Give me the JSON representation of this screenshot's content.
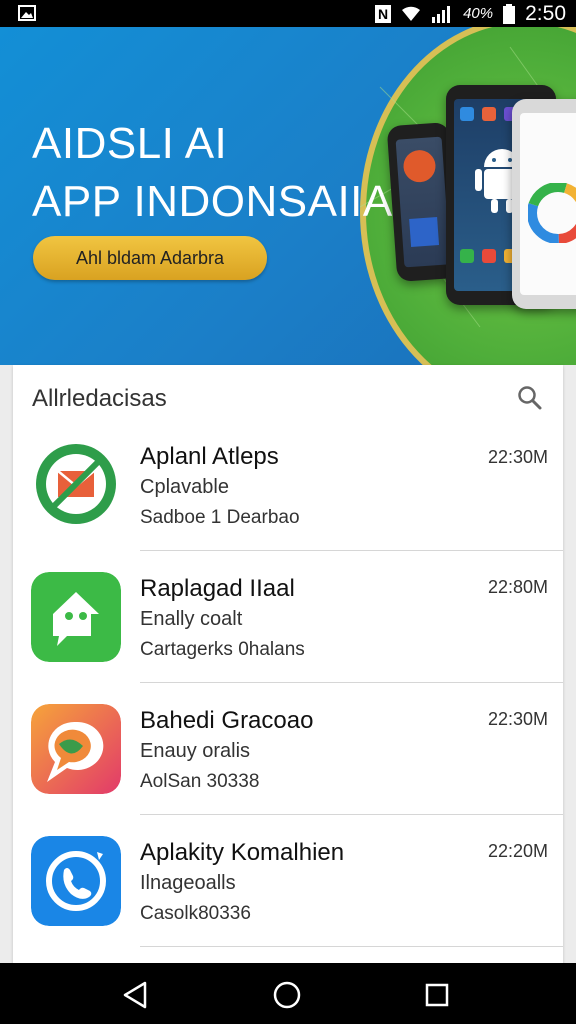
{
  "status_bar": {
    "battery_text": "40%",
    "time": "2:50"
  },
  "banner": {
    "title_line1": "AIDSLI AI",
    "title_line2": "APP INDONSAIIA A",
    "cta_label": "Ahl bldam Adarbra"
  },
  "list": {
    "section_title": "Allrledacisas",
    "items": [
      {
        "name": "Aplanl Atleps",
        "line1": "Cplavable",
        "line2": "Sadboe 1 Dearbao",
        "time": "22:30M",
        "icon": "mail-icon"
      },
      {
        "name": "Raplagad IIaal",
        "line1": "Enally coalt",
        "line2": "Cartagerks 0halans",
        "time": "22:80M",
        "icon": "chat-icon"
      },
      {
        "name": "Bahedi Gracoao",
        "line1": "Enauy oralis",
        "line2": "AolSan 30338",
        "time": "22:30M",
        "icon": "speech-bubble-icon"
      },
      {
        "name": "Aplakity Komalhien",
        "line1": "Ilnageoalls",
        "line2": "Casolk80336",
        "time": "22:20M",
        "icon": "phone-call-icon"
      }
    ]
  },
  "colors": {
    "banner_blue": "#138fd6",
    "banner_green": "#4fae3a",
    "cta_gold": "#e6b32c"
  }
}
